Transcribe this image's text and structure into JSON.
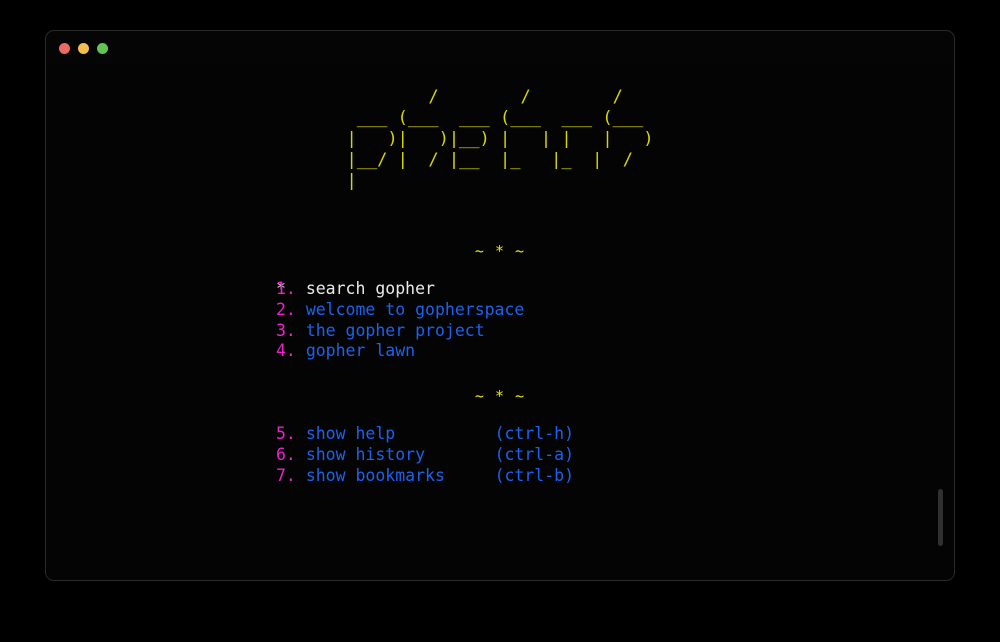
{
  "window": {
    "title": "phetch",
    "traffic_lights": [
      {
        "name": "close",
        "color": "#ec6a5f"
      },
      {
        "name": "minimize",
        "color": "#f4bd4f"
      },
      {
        "name": "maximize",
        "color": "#61c554"
      }
    ]
  },
  "logo": {
    "alt_text": "phetch",
    "color": "#d8d800",
    "ascii": "        /        /        /\n ___ (___  ___ (___  ___ (___\n|   )|   )|__) |   | |   |   )\n|__/ |  / |__  |_   |_  |  /\n|"
  },
  "separators": {
    "top": "~ * ~",
    "bottom": "~ * ~",
    "color": "#e8e800"
  },
  "menu": {
    "cursor_glyph": "*",
    "primary": [
      {
        "num": "1.",
        "label": "search gopher",
        "key": "",
        "selected": true
      },
      {
        "num": "2.",
        "label": "welcome to gopherspace",
        "key": "",
        "selected": false
      },
      {
        "num": "3.",
        "label": "the gopher project",
        "key": "",
        "selected": false
      },
      {
        "num": "4.",
        "label": "gopher lawn",
        "key": "",
        "selected": false
      }
    ],
    "secondary": [
      {
        "num": "5.",
        "label": "show help",
        "key": "(ctrl-h)",
        "selected": false
      },
      {
        "num": "6.",
        "label": "show history",
        "key": "(ctrl-a)",
        "selected": false
      },
      {
        "num": "7.",
        "label": "show bookmarks",
        "key": "(ctrl-b)",
        "selected": false
      }
    ]
  },
  "colors": {
    "background": "#000000",
    "terminal_background": "#040404",
    "number": "#f020d0",
    "link": "#1a62ef",
    "selected_text": "#eaeaea",
    "accent_yellow": "#e8e800",
    "scrollbar_thumb": "#303030"
  },
  "scrollbar": {
    "position_label": "near-bottom"
  }
}
